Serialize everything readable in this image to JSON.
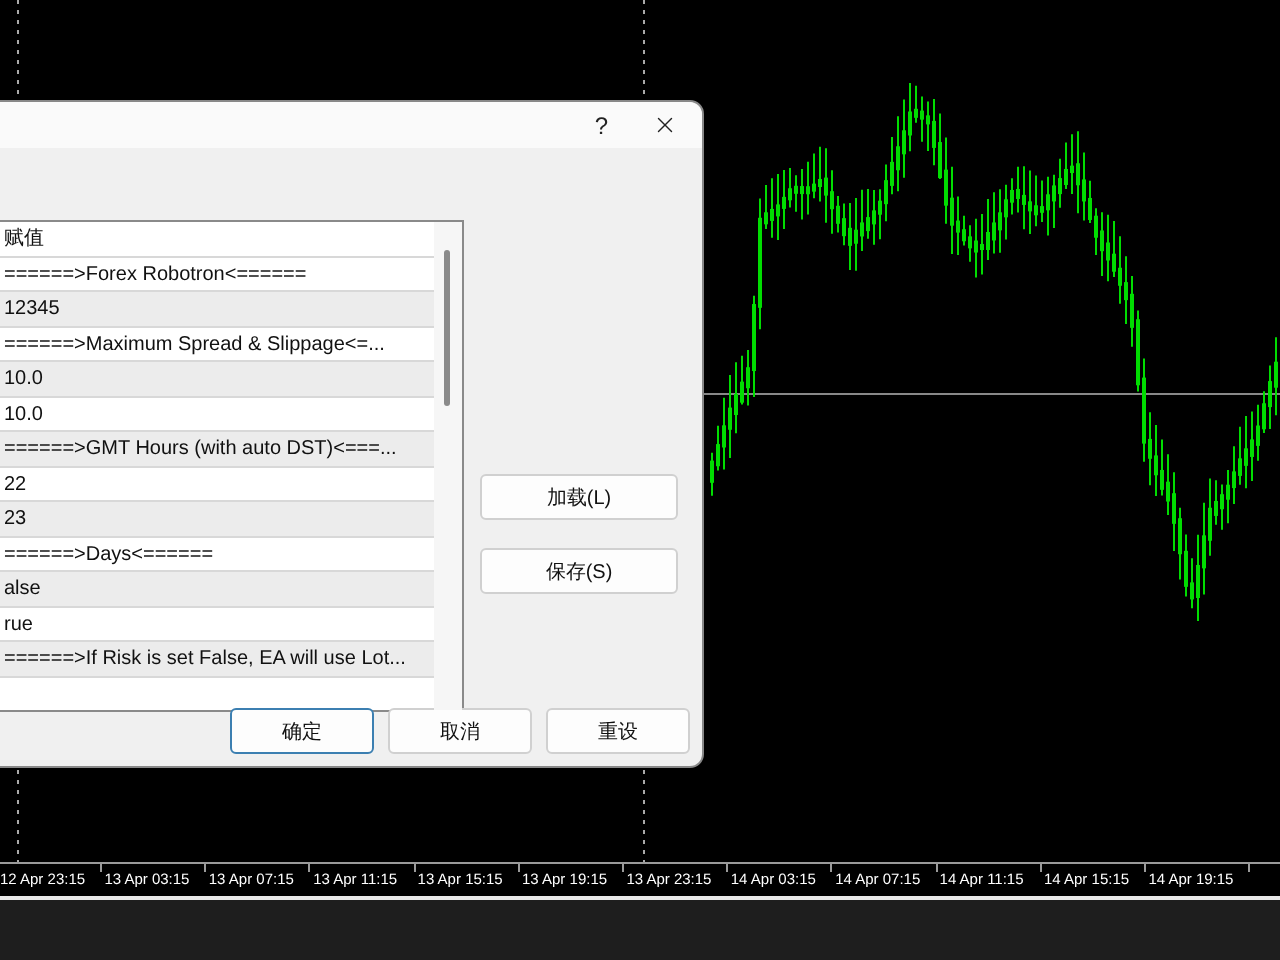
{
  "chart": {
    "time_axis": [
      "12 Apr 23:15",
      "13 Apr 03:15",
      "13 Apr 07:15",
      "13 Apr 11:15",
      "13 Apr 15:15",
      "13 Apr 19:15",
      "13 Apr 23:15",
      "14 Apr 03:15",
      "14 Apr 07:15",
      "14 Apr 11:15",
      "14 Apr 15:15",
      "14 Apr 19:15"
    ]
  },
  "dialog": {
    "help": "?",
    "list": {
      "header": "赋值",
      "rows": [
        {
          "text": "======>Forex Robotron<======"
        },
        {
          "text": "12345"
        },
        {
          "text": "======>Maximum Spread & Slippage<=..."
        },
        {
          "text": "10.0"
        },
        {
          "text": "10.0"
        },
        {
          "text": "======>GMT Hours (with auto DST)<===..."
        },
        {
          "text": "22"
        },
        {
          "text": "23"
        },
        {
          "text": "======>Days<======"
        },
        {
          "text": "alse"
        },
        {
          "text": "rue"
        },
        {
          "text": "======>If Risk is set False, EA will use Lot..."
        }
      ]
    },
    "side_buttons": [
      "加载(L)",
      "保存(S)"
    ],
    "buttons": [
      {
        "label": "确定",
        "default": true
      },
      {
        "label": "取消",
        "default": false
      },
      {
        "label": "重设",
        "default": false
      }
    ]
  }
}
